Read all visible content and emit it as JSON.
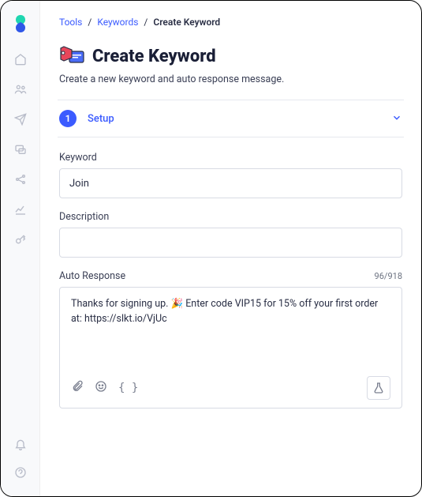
{
  "breadcrumb": {
    "tools": "Tools",
    "keywords": "Keywords",
    "current": "Create Keyword"
  },
  "page": {
    "title": "Create Keyword",
    "subtitle": "Create a new keyword and auto response message."
  },
  "step": {
    "num": "1",
    "label": "Setup"
  },
  "form": {
    "keyword_label": "Keyword",
    "keyword_value": "Join",
    "description_label": "Description",
    "description_value": "",
    "response_label": "Auto Response",
    "char_count": "96/918",
    "response_value": "Thanks for signing up. 🎉 Enter code VIP15 for 15% off your first order at: https://slkt.io/VjUc"
  },
  "toolbar": {
    "curly": "{ }"
  }
}
